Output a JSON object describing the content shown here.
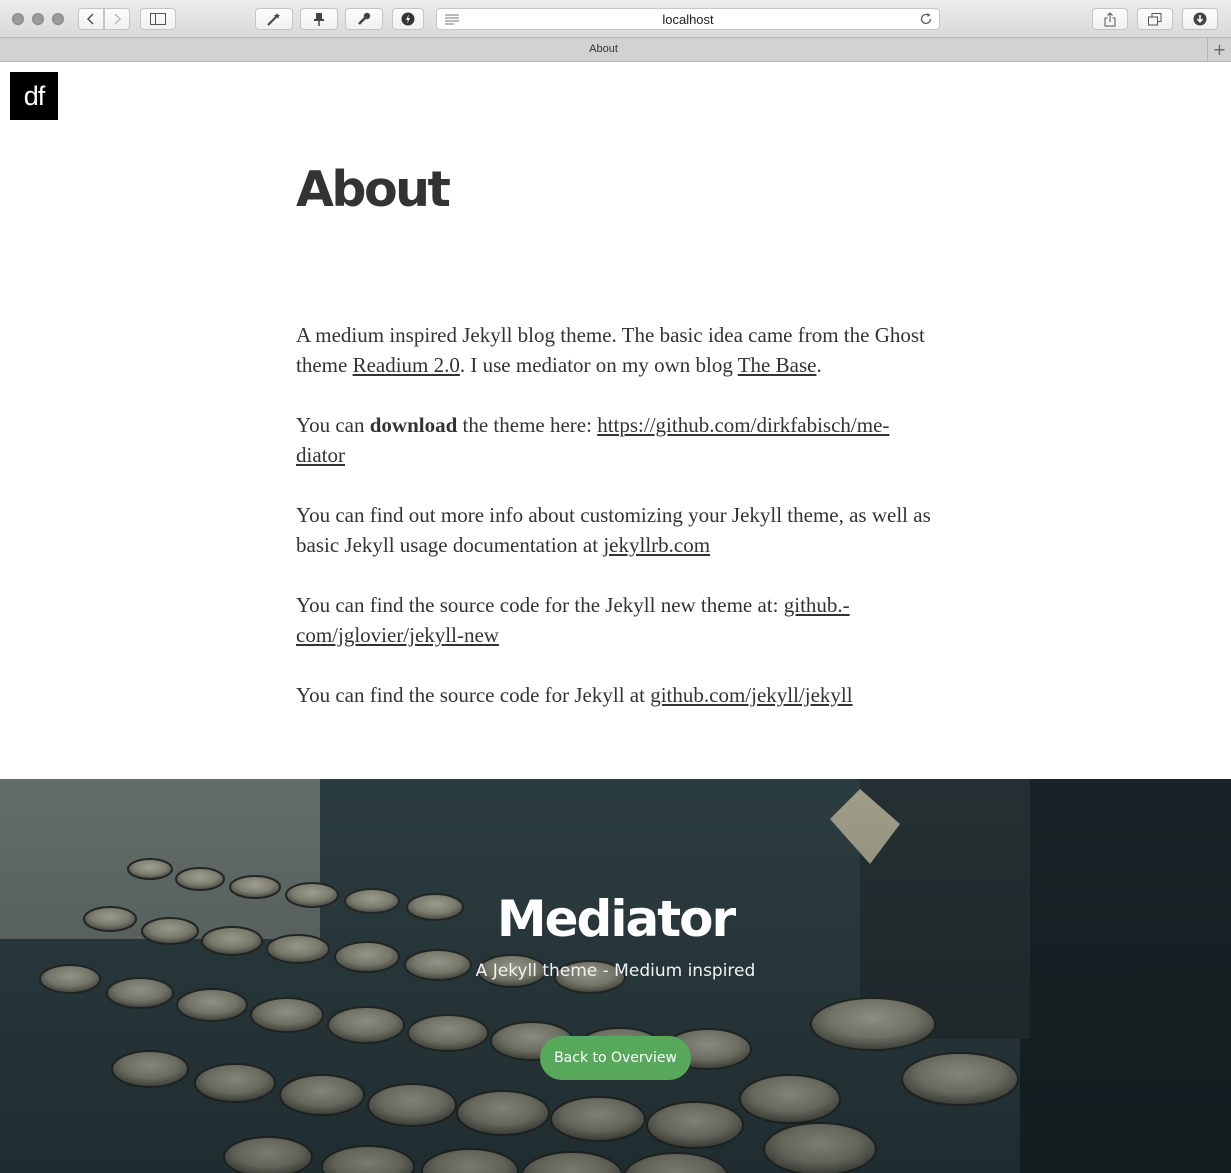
{
  "browser": {
    "url": "localhost",
    "tab_title": "About",
    "new_tab_symbol": "+"
  },
  "site": {
    "logo_text": "df"
  },
  "article": {
    "title": "About",
    "p1": {
      "t1": "A medium inspired Jekyll blog theme. The basic idea came from the Ghost theme ",
      "link1": "Readium 2.0",
      "t2": ". I use mediator on my own blog ",
      "link2": "The Base",
      "t3": "."
    },
    "p2": {
      "t1": "You can ",
      "bold": "download",
      "t2": " the theme here: ",
      "link": "https://github.com/dirkfabisch/me-diator"
    },
    "p3": {
      "t1": "You can find out more info about customizing your Jekyll theme, as well as basic Jekyll usage documentation at ",
      "link": "jekyllrb.com"
    },
    "p4": {
      "t1": "You can find the source code for the Jekyll new theme at: ",
      "link": "github.-com/jglovier/jekyll-new"
    },
    "p5": {
      "t1": "You can find the source code for Jekyll at ",
      "link": "github.com/jekyll/jekyll"
    }
  },
  "footer": {
    "title": "Mediator",
    "subtitle": "A Jekyll theme - Medium inspired",
    "button_label": "Back to Overview",
    "button_color": "#57a85a"
  },
  "icons": {
    "back": "chevron-left-icon",
    "forward": "chevron-right-icon",
    "sidebar": "sidebar-icon",
    "share": "share-icon",
    "tabs": "tabs-icon",
    "downloads": "download-icon"
  }
}
